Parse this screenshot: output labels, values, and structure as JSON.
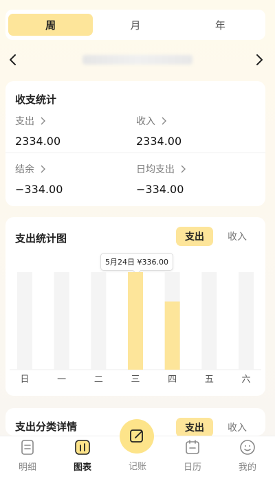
{
  "period_tabs": [
    {
      "label": "周",
      "active": true
    },
    {
      "label": "月",
      "active": false
    },
    {
      "label": "年",
      "active": false
    }
  ],
  "stats": {
    "title": "收支统计",
    "items": [
      {
        "label": "支出",
        "value": "2334.00"
      },
      {
        "label": "收入",
        "value": "2334.00"
      },
      {
        "label": "结余",
        "value": "−334.00"
      },
      {
        "label": "日均支出",
        "value": "−334.00"
      }
    ]
  },
  "chart": {
    "title": "支出统计图",
    "toggle_active": "支出",
    "toggle_inactive": "收入",
    "tooltip": "5月24日 ¥336.00",
    "accent": "#fde59a",
    "track": "#f4f4f4"
  },
  "chart_data": {
    "type": "bar",
    "categories": [
      "日",
      "一",
      "二",
      "三",
      "四",
      "五",
      "六"
    ],
    "values": [
      0,
      0,
      0,
      336,
      235,
      0,
      0
    ],
    "ylim": [
      0,
      336
    ],
    "highlight_index": 3
  },
  "category_card": {
    "title_partial": "支出分类详情",
    "toggle_active": "支出",
    "toggle_inactive": "收入"
  },
  "tabbar": {
    "items": [
      {
        "label": "明细",
        "icon": "list-doc-icon",
        "active": false
      },
      {
        "label": "图表",
        "icon": "bar-chart-icon",
        "active": true
      },
      {
        "label": "记账",
        "icon": "edit-icon",
        "active": false
      },
      {
        "label": "日历",
        "icon": "calendar-icon",
        "active": false
      },
      {
        "label": "我的",
        "icon": "smiley-icon",
        "active": false
      }
    ]
  }
}
